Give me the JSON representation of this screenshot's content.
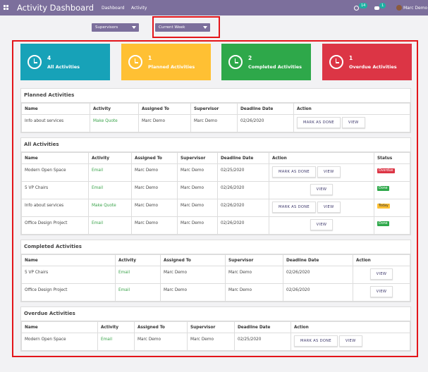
{
  "navbar": {
    "title": "Activity Dashboard",
    "menu": [
      "Dashboard",
      "Activity"
    ],
    "activity_count": "14",
    "message_count": "1",
    "user": "Marc Demo"
  },
  "filters": {
    "user_filter": "Supervisors",
    "period_filter": "Current Week"
  },
  "cards": [
    {
      "count": "4",
      "label": "All Activities",
      "color": "#17a2b8"
    },
    {
      "count": "1",
      "label": "Planned Activities",
      "color": "#ffc033"
    },
    {
      "count": "2",
      "label": "Completed Activities",
      "color": "#2ea84a"
    },
    {
      "count": "1",
      "label": "Overdue Activities",
      "color": "#dc3545"
    }
  ],
  "buttons": {
    "mark_done": "MARK AS DONE",
    "view": "VIEW"
  },
  "planned": {
    "title": "Planned Activities",
    "headers": [
      "Name",
      "Activity",
      "Assigned To",
      "Supervisor",
      "Deadline Date",
      "Action"
    ],
    "rows": [
      {
        "name": "Info about services",
        "activity": "Make Quote",
        "assigned": "Marc Demo",
        "supervisor": "Marc Demo",
        "deadline": "02/26/2020"
      }
    ]
  },
  "all": {
    "title": "All Activities",
    "headers": [
      "Name",
      "Activity",
      "Assigned To",
      "Supervisor",
      "Deadline Date",
      "Action",
      "Status"
    ],
    "rows": [
      {
        "name": "Modern Open Space",
        "activity": "Email",
        "assigned": "Marc Demo",
        "supervisor": "Marc Demo",
        "deadline": "02/25/2020",
        "status": "Overdue",
        "status_color": "#dc3545"
      },
      {
        "name": "5 VP Chairs",
        "activity": "Email",
        "assigned": "Marc Demo",
        "supervisor": "Marc Demo",
        "deadline": "02/26/2020",
        "status": "Done",
        "status_color": "#2ea84a"
      },
      {
        "name": "Info about services",
        "activity": "Make Quote",
        "assigned": "Marc Demo",
        "supervisor": "Marc Demo",
        "deadline": "02/26/2020",
        "status": "Today",
        "status_color": "#ffc033"
      },
      {
        "name": "Office Design Project",
        "activity": "Email",
        "assigned": "Marc Demo",
        "supervisor": "Marc Demo",
        "deadline": "02/26/2020",
        "status": "Done",
        "status_color": "#2ea84a"
      }
    ]
  },
  "completed": {
    "title": "Completed Activities",
    "headers": [
      "Name",
      "Activity",
      "Assigned To",
      "Supervisor",
      "Deadline Date",
      "Action"
    ],
    "rows": [
      {
        "name": "5 VP Chairs",
        "activity": "Email",
        "assigned": "Marc Demo",
        "supervisor": "Marc Demo",
        "deadline": "02/26/2020"
      },
      {
        "name": "Office Design Project",
        "activity": "Email",
        "assigned": "Marc Demo",
        "supervisor": "Marc Demo",
        "deadline": "02/26/2020"
      }
    ]
  },
  "overdue": {
    "title": "Overdue Activities",
    "headers": [
      "Name",
      "Activity",
      "Assigned To",
      "Supervisor",
      "Deadline Date",
      "Action"
    ],
    "rows": [
      {
        "name": "Modern Open Space",
        "activity": "Email",
        "assigned": "Marc Demo",
        "supervisor": "Marc Demo",
        "deadline": "02/25/2020"
      }
    ]
  }
}
